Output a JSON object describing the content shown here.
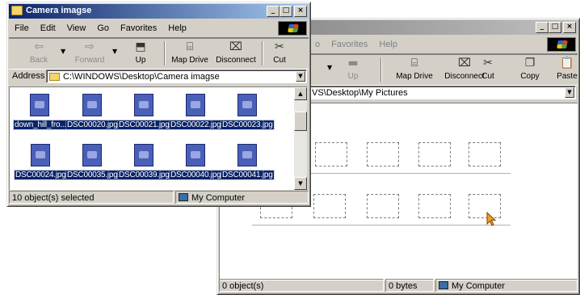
{
  "front_window": {
    "title": "Camera imagse",
    "menu": [
      "File",
      "Edit",
      "View",
      "Go",
      "Favorites",
      "Help"
    ],
    "toolbar": {
      "back": "Back",
      "forward": "Forward",
      "up": "Up",
      "map_drive": "Map Drive",
      "disconnect": "Disconnect",
      "cut": "Cut"
    },
    "address_label": "Address",
    "address_value": "C:\\WINDOWS\\Desktop\\Camera imagse",
    "files": [
      "down_hill_fro...",
      "DSC00020.jpg",
      "DSC00021.jpg",
      "DSC00022.jpg",
      "DSC00023.jpg",
      "DSC00024.jpg",
      "DSC00035.jpg",
      "DSC00039.jpg",
      "DSC00040.jpg",
      "DSC00041.jpg"
    ],
    "status_left": "10 object(s) selected",
    "status_right": "My Computer"
  },
  "back_window": {
    "menu": [
      "o",
      "Favorites",
      "Help"
    ],
    "toolbar": {
      "up": "Up",
      "map_drive": "Map Drive",
      "disconnect": "Disconnect",
      "cut": "Cut",
      "copy": "Copy",
      "paste": "Paste"
    },
    "address_value": "VS\\Desktop\\My Pictures",
    "status_left": "0 object(s)",
    "status_mid": "0 bytes",
    "status_right": "My Computer"
  },
  "icons": {
    "title": "folder-icon",
    "back": "left-arrow-icon",
    "forward": "right-arrow-icon",
    "up": "up-folder-icon",
    "map_drive": "map-drive-icon",
    "disconnect": "disconnect-drive-icon",
    "cut": "scissors-icon",
    "copy": "copy-icon",
    "paste": "paste-icon",
    "file": "image-file-icon",
    "computer": "computer-icon",
    "cursor": "arrow-cursor-icon"
  },
  "colors": {
    "titlebar_active": "#0a246a",
    "titlebar_inactive": "#808080",
    "selection": "#0a246a",
    "window_face": "#d4d0c8"
  }
}
